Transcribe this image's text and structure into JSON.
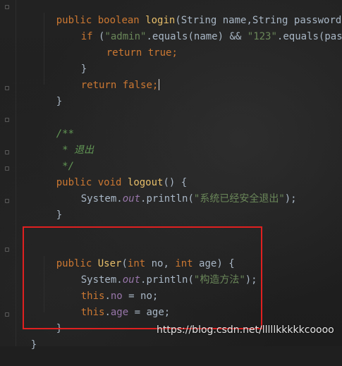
{
  "editor": {
    "lines": {
      "l1": {
        "t1": "public ",
        "t2": "boolean ",
        "t3": "login",
        "t4": "(String name,String password)"
      },
      "l2": {
        "t1": "if ",
        "t2": "(",
        "t3": "\"admin\"",
        "t4": ".equals(name) && ",
        "t5": "\"123\"",
        "t6": ".equals(pass"
      },
      "l3": {
        "t1": "return ",
        "t2": "true",
        "t3": ";"
      },
      "l4": {
        "t1": "}"
      },
      "l5": {
        "t1": "return ",
        "t2": "false",
        "t3": ";"
      },
      "l6": {
        "t1": "}"
      },
      "l7": {
        "t1": "/**"
      },
      "l8": {
        "t1": " * 退出"
      },
      "l9": {
        "t1": " */"
      },
      "l10": {
        "t1": "public ",
        "t2": "void ",
        "t3": "logout",
        "t4": "() {"
      },
      "l11": {
        "t1": "System.",
        "t2": "out",
        "t3": ".println(",
        "t4": "\"系统已经安全退出\"",
        "t5": ");"
      },
      "l12": {
        "t1": "}"
      },
      "l13": {
        "t1": "public ",
        "t2": "User",
        "t3": "(",
        "t4": "int ",
        "t5": "no, ",
        "t6": "int ",
        "t7": "age) {"
      },
      "l14": {
        "t1": "System.",
        "t2": "out",
        "t3": ".println(",
        "t4": "\"构造方法\"",
        "t5": ");"
      },
      "l15": {
        "t1": "this",
        "t2": ".",
        "t3": "no",
        "t4": " = no;"
      },
      "l16": {
        "t1": "this",
        "t2": ".",
        "t3": "age",
        "t4": " = age;"
      },
      "l17": {
        "t1": "}"
      },
      "l18": {
        "t1": "}"
      }
    }
  },
  "watermark": {
    "text": "https://blog.csdn.net/lllllkkkkkcoooo"
  },
  "colors": {
    "keyword": "#cc7832",
    "string": "#6a8759",
    "field": "#9876aa",
    "doc_comment": "#629755",
    "default_text": "#a9b7c6",
    "highlight_box": "#e02020"
  }
}
